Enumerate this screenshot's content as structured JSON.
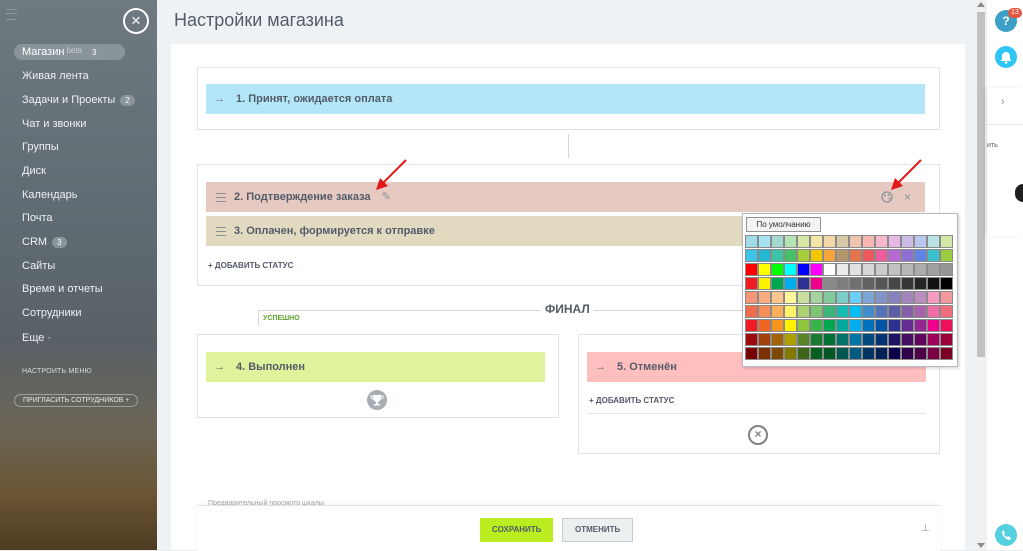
{
  "sidebar": {
    "items": [
      {
        "label": "Магазин",
        "beta": "beta",
        "badge": "3"
      },
      {
        "label": "Живая лента"
      },
      {
        "label": "Задачи и Проекты",
        "badge": "2"
      },
      {
        "label": "Чат и звонки"
      },
      {
        "label": "Группы"
      },
      {
        "label": "Диск"
      },
      {
        "label": "Календарь"
      },
      {
        "label": "Почта"
      },
      {
        "label": "CRM",
        "badge": "3"
      },
      {
        "label": "Сайты"
      },
      {
        "label": "Время и отчеты"
      },
      {
        "label": "Сотрудники"
      },
      {
        "label": "Еще ·"
      }
    ],
    "configure_menu": "НАСТРОИТЬ МЕНЮ",
    "invite": "ПРИГЛАСИТЬ СОТРУДНИКОВ +"
  },
  "header": {
    "title": "Настройки магазина"
  },
  "statuses": {
    "s1": {
      "label": "1. Принят, ожидается оплата",
      "color": "#b3e7f7"
    },
    "s2": {
      "label": "2. Подтверждение заказа",
      "color": "#e6c9c1"
    },
    "s3": {
      "label": "3. Оплачен, формируется к отправке",
      "color": "#e2d9c1"
    },
    "s4": {
      "label": "4. Выполнен",
      "color": "#dff29c"
    },
    "s5": {
      "label": "5. Отменён",
      "color": "#ffbfbf"
    }
  },
  "add_status_label": "+ ДОБАВИТЬ СТАТУС",
  "final_label": "ФИНАЛ",
  "success_label": "УСПЕШНО",
  "footer": {
    "save": "СОХРАНИТЬ",
    "cancel": "ОТМЕНИТЬ",
    "hint": "Предварительный просмотр шкалы"
  },
  "color_picker": {
    "default_label": "По умолчанию",
    "rows": [
      [
        "#9fdbe9",
        "#a6e3f0",
        "#a4d9d0",
        "#b4e3b4",
        "#d7e8a6",
        "#f2e5a7",
        "#f5d6a7",
        "#d9c9a9",
        "#f0c5b0",
        "#f8b7b0",
        "#f6b9cc",
        "#e6b9e4",
        "#cbbde8",
        "#b7c7ee",
        "#b7e3e4",
        "#d2e8a9"
      ],
      [
        "#3dc3e8",
        "#25b6d2",
        "#3cc3a8",
        "#47bf64",
        "#a7ce3a",
        "#f3c700",
        "#f7a43a",
        "#b4966e",
        "#e2744e",
        "#ea5a5a",
        "#ed5e9f",
        "#b96ad2",
        "#8f6ed5",
        "#5d84e3",
        "#3bc0cd",
        "#9acb40"
      ],
      [
        "#ff0000",
        "#ffff00",
        "#00ff00",
        "#00ffff",
        "#0000ff",
        "#ff00ff",
        "#ffffff",
        "#ebebeb",
        "#e1e1e1",
        "#d7d7d7",
        "#cccccc",
        "#c2c2c2",
        "#b7b7b7",
        "#acacac",
        "#a0a0a0",
        "#959595"
      ],
      [
        "#ee1d24",
        "#fff100",
        "#00a650",
        "#00aeef",
        "#2f3192",
        "#ed008c",
        "#898989",
        "#7d7d7d",
        "#707070",
        "#626262",
        "#555555",
        "#464646",
        "#363636",
        "#262626",
        "#111111",
        "#000000"
      ],
      [
        "#f7977a",
        "#fbad82",
        "#fdc68c",
        "#fff799",
        "#c6df9c",
        "#a4d49d",
        "#81ca9d",
        "#7bcdc9",
        "#6ccff7",
        "#7ca6d8",
        "#8293ca",
        "#8881be",
        "#a286bd",
        "#bc8cbf",
        "#f49bc1",
        "#f5999d"
      ],
      [
        "#f16c4d",
        "#f68e55",
        "#fbaf5a",
        "#fff467",
        "#acd372",
        "#7dc473",
        "#39b778",
        "#16bcb4",
        "#00bff3",
        "#438ccb",
        "#5573b7",
        "#5e5ca7",
        "#855fa8",
        "#a763a9",
        "#ef6ea8",
        "#f16d7e"
      ],
      [
        "#ee1d24",
        "#f16522",
        "#f7941d",
        "#fff100",
        "#8fc63d",
        "#37b44a",
        "#00a650",
        "#00a99e",
        "#00aeef",
        "#0072bc",
        "#0054a5",
        "#2f3192",
        "#652c91",
        "#91278f",
        "#ed008c",
        "#ee105a"
      ],
      [
        "#9d0a0f",
        "#a1410d",
        "#a36209",
        "#aba000",
        "#588528",
        "#197b30",
        "#007236",
        "#00736a",
        "#0076a4",
        "#004a80",
        "#003370",
        "#1d1363",
        "#450e61",
        "#62055f",
        "#9e005c",
        "#9d0039"
      ],
      [
        "#790000",
        "#7b3000",
        "#7c4900",
        "#827a00",
        "#3e6617",
        "#045f20",
        "#005824",
        "#005951",
        "#005b7e",
        "#003562",
        "#002056",
        "#0c004b",
        "#30004a",
        "#4b0048",
        "#7a0045",
        "#7a0026"
      ]
    ]
  },
  "rightbar": {
    "help": "?",
    "badge": "13",
    "fragment": "ить"
  },
  "colors": {
    "save_green": "#bbed21",
    "accent_blue": "#2fc6f6",
    "call_green": "#55d0e0"
  }
}
